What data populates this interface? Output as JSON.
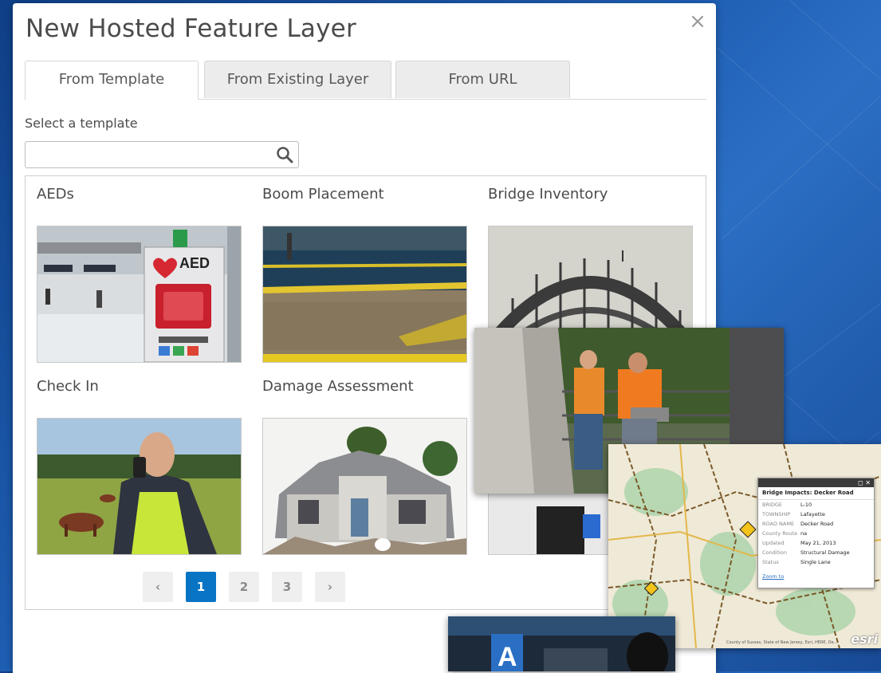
{
  "dialog": {
    "title": "New Hosted Feature Layer",
    "close_icon": "×"
  },
  "tabs": [
    {
      "label": "From Template",
      "active": true
    },
    {
      "label": "From Existing Layer",
      "active": false
    },
    {
      "label": "From URL",
      "active": false
    }
  ],
  "template_picker": {
    "label": "Select a template",
    "search_value": "",
    "search_placeholder": ""
  },
  "templates": [
    {
      "title": "AEDs",
      "thumbnail": "aed-cabinet-photo"
    },
    {
      "title": "Boom Placement",
      "thumbnail": "oil-boom-beach-photo"
    },
    {
      "title": "Bridge Inventory",
      "thumbnail": "steel-arch-bridge-photo"
    },
    {
      "title": "Check In",
      "thumbnail": "worker-phone-cows-photo"
    },
    {
      "title": "Damage Assessment",
      "thumbnail": "damaged-house-photo"
    },
    {
      "title": "",
      "thumbnail": "partially-hidden-photo"
    }
  ],
  "pagination": {
    "prev_icon": "‹",
    "next_icon": "›",
    "pages": [
      "1",
      "2",
      "3"
    ],
    "current": 1
  },
  "map_popup": {
    "title": "Bridge Impacts: Decker Road",
    "fields": [
      {
        "key": "BRIDGE",
        "value": "L-10"
      },
      {
        "key": "TOWNSHIP",
        "value": "Lafayette"
      },
      {
        "key": "ROAD NAME",
        "value": "Decker Road"
      },
      {
        "key": "County Route",
        "value": "na"
      },
      {
        "key": "Updated",
        "value": "May 21, 2013"
      },
      {
        "key": "Condition",
        "value": "Structural Damage"
      },
      {
        "key": "Status",
        "value": "Single Lane"
      }
    ],
    "link": "Zoom to",
    "head_icons": "◻ ✕"
  },
  "map": {
    "credit": "County of Sussex, State of New Jersey, Esri, HERE, De...",
    "logo": "esri"
  },
  "colors": {
    "accent": "#0a74c4",
    "background": "#1f5fb4"
  }
}
